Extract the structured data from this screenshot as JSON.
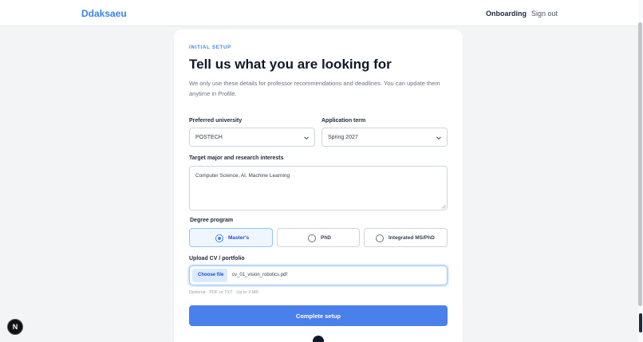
{
  "header": {
    "logo": "Ddaksaeu",
    "nav": {
      "onboarding": "Onboarding",
      "sign_out": "Sign out"
    }
  },
  "setup": {
    "eyebrow": "INITIAL SETUP",
    "title": "Tell us what you are looking for",
    "subtitle": "We only use these details for professor recommendations and deadlines. You can update them anytime in Profile.",
    "university": {
      "label": "Preferred university",
      "value": "POSTECH"
    },
    "term": {
      "label": "Application term",
      "value": "Spring 2027"
    },
    "interests": {
      "label": "Target major and research interests",
      "value": "Computer Science, AI, Machine Learning"
    },
    "degree": {
      "label": "Degree program",
      "options": [
        "Master's",
        "PhD",
        "Integrated MS/PhD"
      ],
      "selected": "Master's"
    },
    "upload": {
      "label": "Upload CV / portfolio",
      "button": "Choose file",
      "filename": "cv_01_vision_robotics.pdf",
      "hint": "Optional · PDF or TXT · Up to 3 MB"
    },
    "submit": "Complete setup"
  },
  "dev_badge": "N",
  "colors": {
    "accent": "#3b82f6",
    "button": "#4a80ec",
    "selected_bg": "#eff6ff"
  }
}
